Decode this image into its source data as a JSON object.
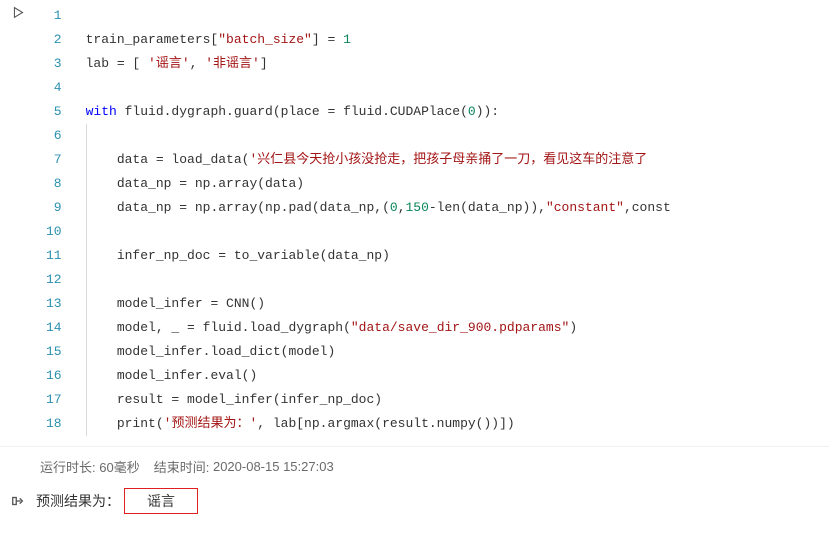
{
  "code": {
    "lines": [
      {
        "num": 1,
        "indent": 0,
        "segments": []
      },
      {
        "num": 2,
        "indent": 0,
        "segments": [
          {
            "t": "train_parameters["
          },
          {
            "t": "\"batch_size\"",
            "c": "s"
          },
          {
            "t": "]"
          },
          {
            "t": " = ",
            "c": "op"
          },
          {
            "t": "1",
            "c": "n"
          }
        ]
      },
      {
        "num": 3,
        "indent": 0,
        "segments": [
          {
            "t": "lab = [ "
          },
          {
            "t": "'谣言'",
            "c": "s"
          },
          {
            "t": ", "
          },
          {
            "t": "'非谣言'",
            "c": "s"
          },
          {
            "t": "]"
          }
        ]
      },
      {
        "num": 4,
        "indent": 0,
        "segments": []
      },
      {
        "num": 5,
        "indent": 0,
        "segments": [
          {
            "t": "with",
            "c": "k"
          },
          {
            "t": " fluid.dygraph.guard(place = fluid.CUDAPlace("
          },
          {
            "t": "0",
            "c": "n"
          },
          {
            "t": ")):"
          }
        ]
      },
      {
        "num": 6,
        "indent": 1,
        "segments": []
      },
      {
        "num": 7,
        "indent": 1,
        "segments": [
          {
            "t": "data = load_data("
          },
          {
            "t": "'兴仁县今天抢小孩没抢走，把孩子母亲捅了一刀，看见这车的注意了",
            "c": "s"
          }
        ]
      },
      {
        "num": 8,
        "indent": 1,
        "segments": [
          {
            "t": "data_np = np.array(data)"
          }
        ]
      },
      {
        "num": 9,
        "indent": 1,
        "segments": [
          {
            "t": "data_np = np.array(np.pad(data_np,("
          },
          {
            "t": "0",
            "c": "n"
          },
          {
            "t": ","
          },
          {
            "t": "150",
            "c": "n"
          },
          {
            "t": "-len(data_np)),"
          },
          {
            "t": "\"constant\"",
            "c": "s"
          },
          {
            "t": ",const"
          }
        ]
      },
      {
        "num": 10,
        "indent": 1,
        "segments": []
      },
      {
        "num": 11,
        "indent": 1,
        "segments": [
          {
            "t": "infer_np_doc = to_variable(data_np)"
          }
        ]
      },
      {
        "num": 12,
        "indent": 1,
        "segments": []
      },
      {
        "num": 13,
        "indent": 1,
        "segments": [
          {
            "t": "model_infer = CNN()"
          }
        ]
      },
      {
        "num": 14,
        "indent": 1,
        "segments": [
          {
            "t": "model, _ = fluid.load_dygraph("
          },
          {
            "t": "\"data/save_dir_900.pdparams\"",
            "c": "s"
          },
          {
            "t": ")"
          }
        ]
      },
      {
        "num": 15,
        "indent": 1,
        "segments": [
          {
            "t": "model_infer.load_dict(model)"
          }
        ]
      },
      {
        "num": 16,
        "indent": 1,
        "segments": [
          {
            "t": "model_infer.eval()"
          }
        ]
      },
      {
        "num": 17,
        "indent": 1,
        "segments": [
          {
            "t": "result = model_infer(infer_np_doc)"
          }
        ]
      },
      {
        "num": 18,
        "indent": 1,
        "segments": [
          {
            "t": "print("
          },
          {
            "t": "'预测结果为：'",
            "c": "s"
          },
          {
            "t": ", lab[np.argmax(result.numpy())])"
          }
        ]
      }
    ]
  },
  "meta": {
    "runtime_label": "运行时长:",
    "runtime_value": "60毫秒",
    "end_label": "结束时间:",
    "end_value": "2020-08-15 15:27:03"
  },
  "output": {
    "label": "预测结果为：",
    "value": "谣言"
  }
}
